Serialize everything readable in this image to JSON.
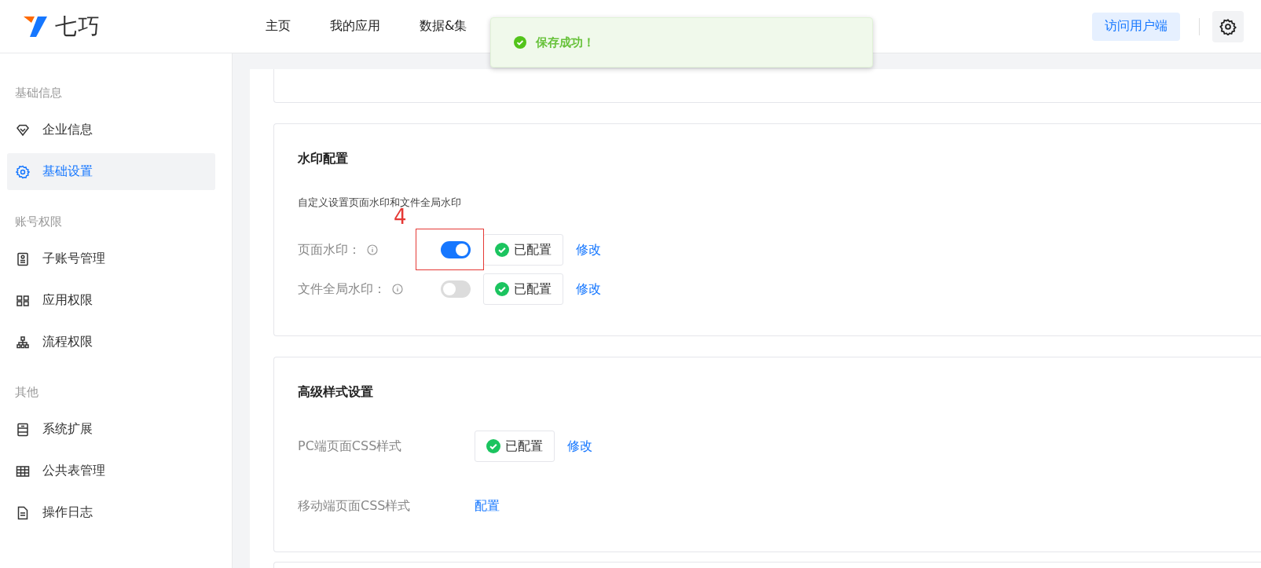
{
  "header": {
    "logo": "七巧",
    "nav": [
      {
        "label": "主页"
      },
      {
        "label": "我的应用"
      },
      {
        "label": "数据&集"
      }
    ],
    "visit_button": "访问用户端"
  },
  "toast": {
    "message": "保存成功！"
  },
  "sidebar": {
    "groups": [
      {
        "title": "基础信息",
        "items": [
          {
            "label": "企业信息",
            "kind": "diamond",
            "selected": false
          },
          {
            "label": "基础设置",
            "kind": "gear",
            "selected": true
          }
        ]
      },
      {
        "title": "账号权限",
        "items": [
          {
            "label": "子账号管理",
            "kind": "badge",
            "selected": false
          },
          {
            "label": "应用权限",
            "kind": "grid",
            "selected": false
          },
          {
            "label": "流程权限",
            "kind": "tree",
            "selected": false
          }
        ]
      },
      {
        "title": "其他",
        "items": [
          {
            "label": "系统扩展",
            "kind": "cabinet",
            "selected": false
          },
          {
            "label": "公共表管理",
            "kind": "table",
            "selected": false
          },
          {
            "label": "操作日志",
            "kind": "file",
            "selected": false
          }
        ]
      }
    ]
  },
  "watermark": {
    "title": "水印配置",
    "description": "自定义设置页面水印和文件全局水印",
    "rows": [
      {
        "label": "页面水印：",
        "on": true,
        "status": "已配置",
        "action": "修改",
        "annotation": "4"
      },
      {
        "label": "文件全局水印：",
        "on": false,
        "status": "已配置",
        "action": "修改"
      }
    ]
  },
  "advanced": {
    "title": "高级样式设置",
    "rows": [
      {
        "label": "PC端页面CSS样式",
        "status": "已配置",
        "action": "修改"
      },
      {
        "label": "移动端页面CSS样式",
        "action": "配置"
      }
    ]
  }
}
